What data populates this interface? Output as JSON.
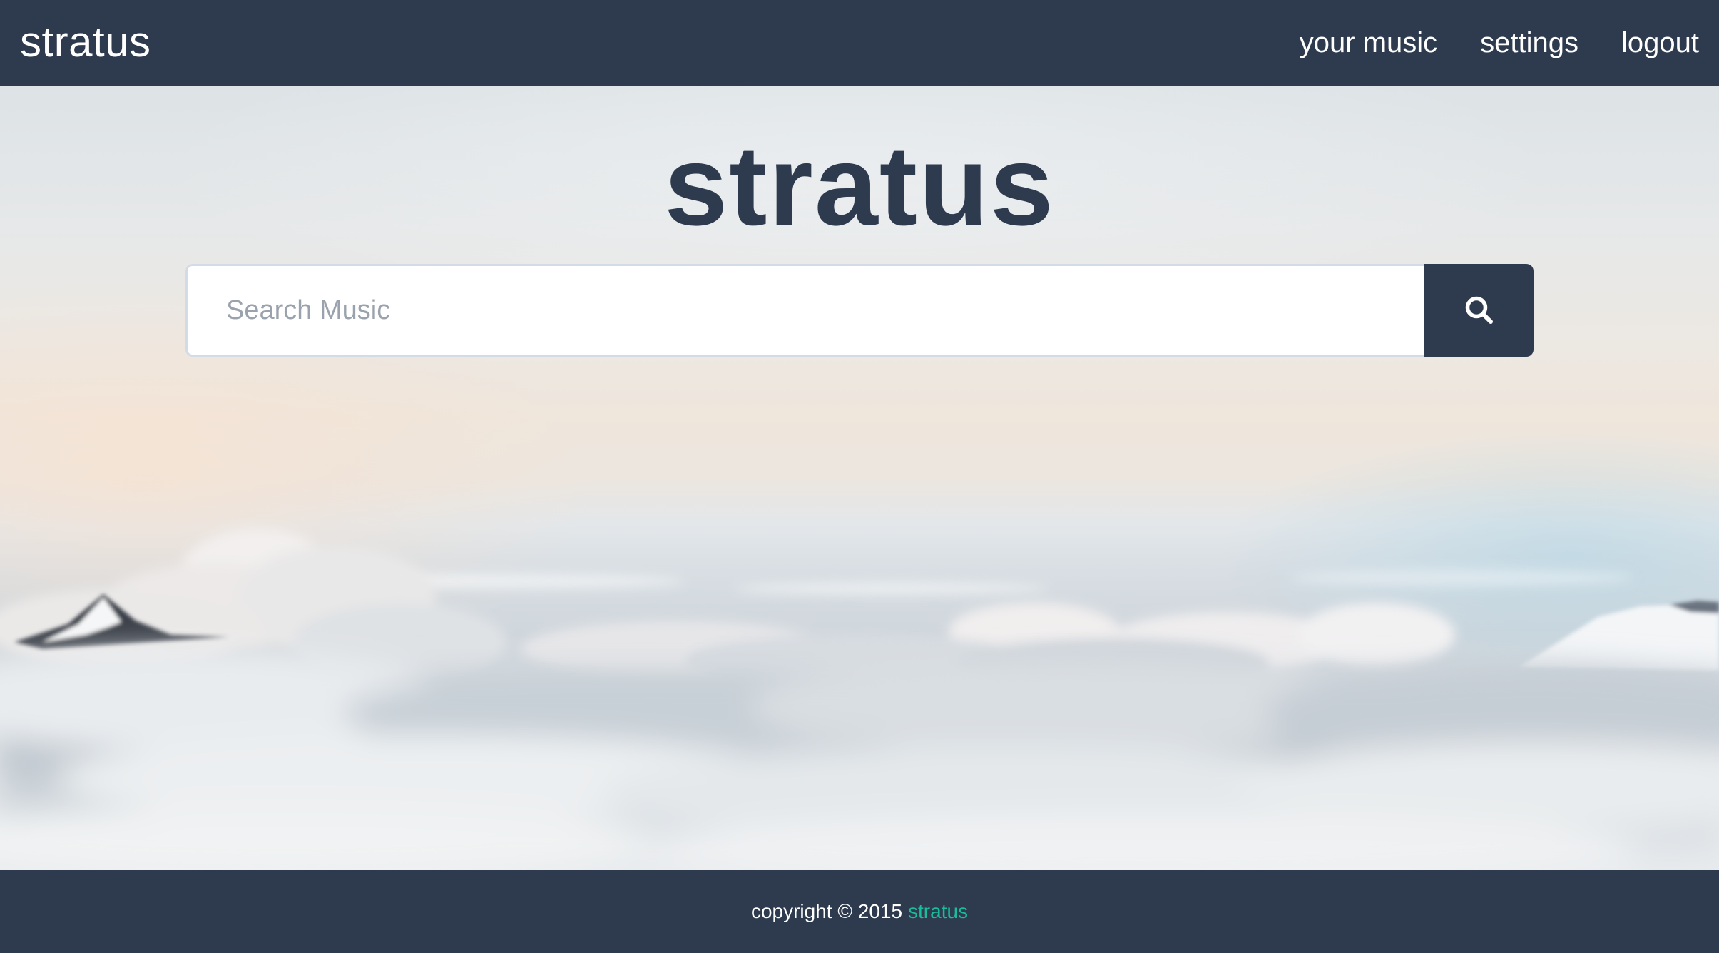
{
  "navbar": {
    "brand": "stratus",
    "links": [
      {
        "label": "your music"
      },
      {
        "label": "settings"
      },
      {
        "label": "logout"
      }
    ]
  },
  "hero": {
    "title": "stratus"
  },
  "search": {
    "placeholder": "Search Music",
    "value": "",
    "button_icon": "search-icon"
  },
  "footer": {
    "copyright_text": "copyright © 2015",
    "link_label": "stratus"
  },
  "colors": {
    "navbar_bg": "#2e3b4f",
    "footer_link": "#1abc9c",
    "title": "#2e3b4f",
    "input_border": "#d3dbe6",
    "placeholder": "#9aa3ad"
  }
}
